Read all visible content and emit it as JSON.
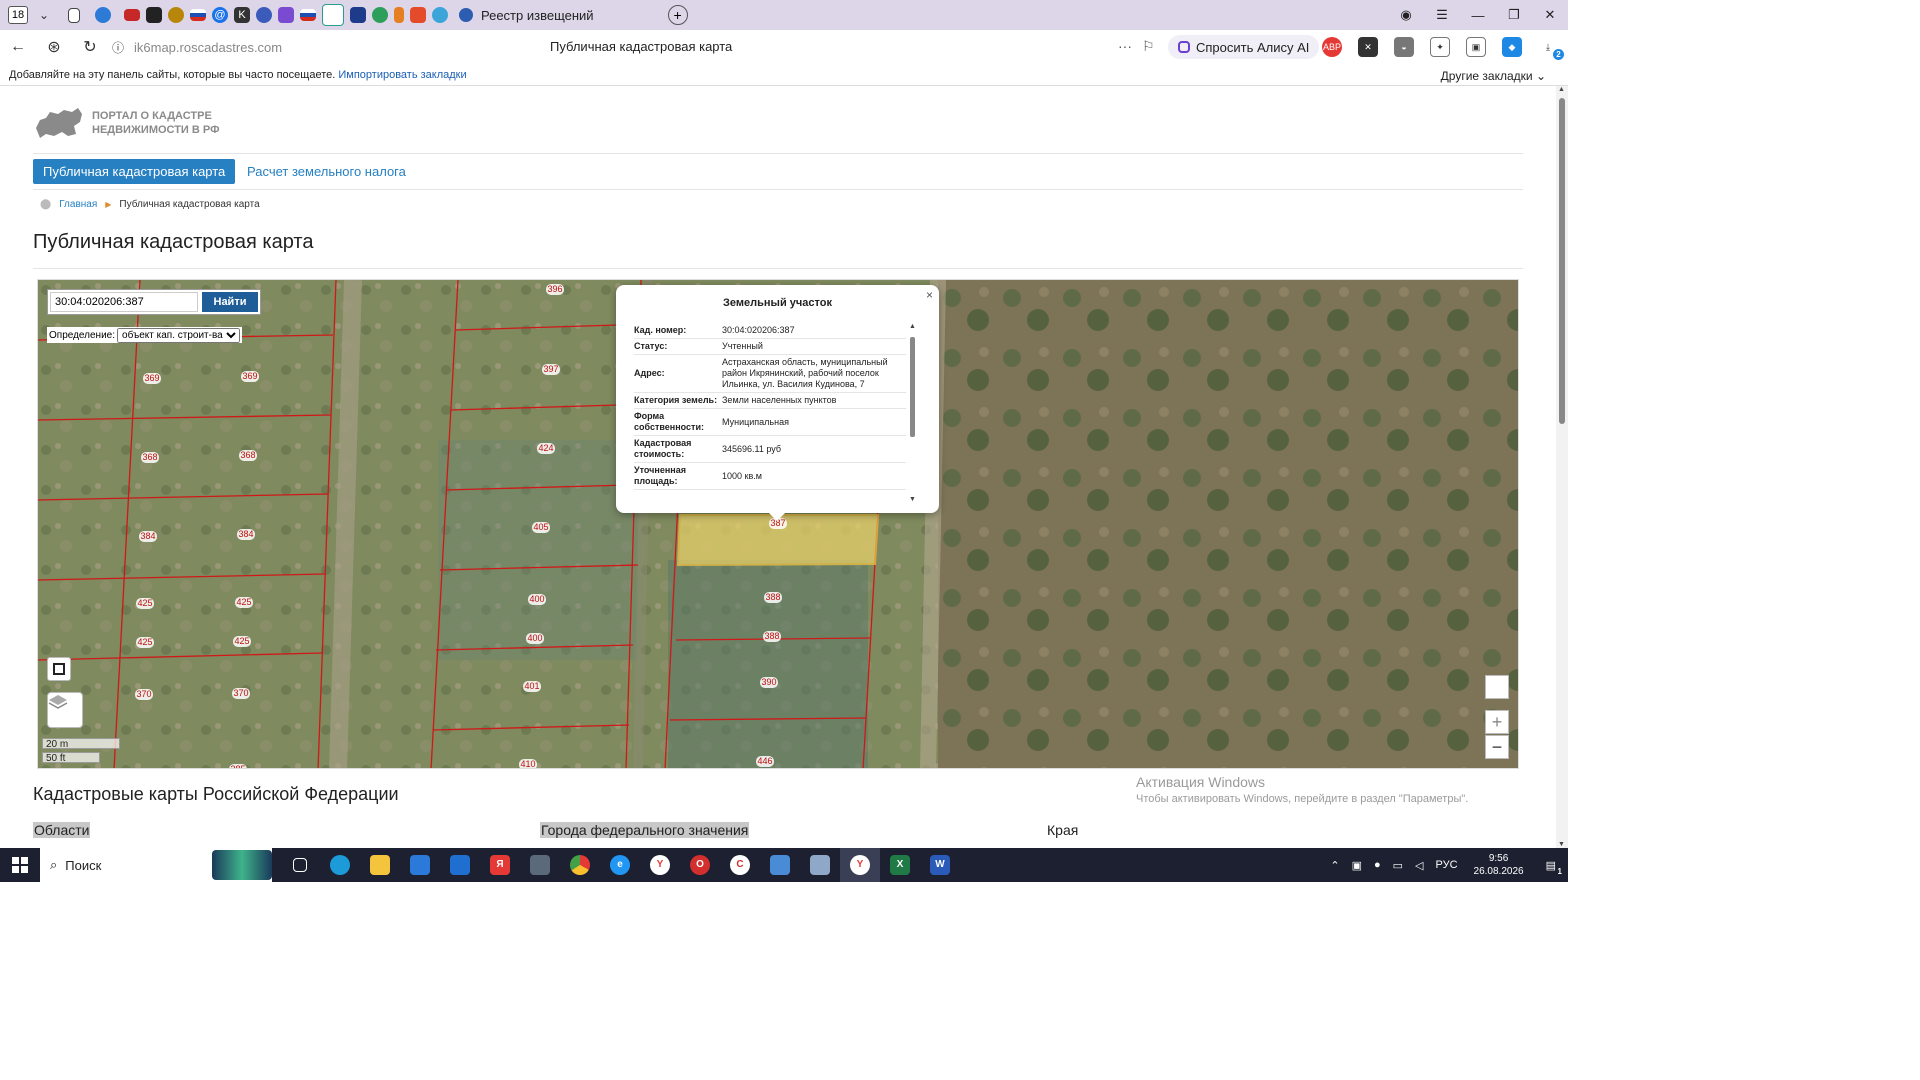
{
  "browser": {
    "tab_count": "18",
    "active_tab_title": "Реестр извещений",
    "url": "ik6map.roscadastres.com",
    "page_title": "Публичная кадастровая карта",
    "alisa_label": "Спросить Алису AI",
    "bookmarks_hint": "Добавляйте на эту панель сайты, которые вы часто посещаете.",
    "bookmarks_import": "Импортировать закладки",
    "other_bookmarks": "Другие закладки",
    "downloads_badge": "2"
  },
  "site": {
    "logo_line1": "ПОРТАЛ О КАДАСТРЕ",
    "logo_line2": "НЕДВИЖИМОСТИ В РФ",
    "nav_active": "Публичная кадастровая карта",
    "nav_other": "Расчет земельного налога",
    "breadcrumb_home": "Главная",
    "breadcrumb_current": "Публичная кадастровая карта",
    "heading": "Публичная кадастровая карта",
    "section_title": "Кадастровые карты Российской Федерации",
    "columns": [
      "Области",
      "Города федерального значения",
      "Края"
    ]
  },
  "map": {
    "search_value": "30:04:020206:387",
    "search_button": "Найти",
    "define_label": "Определение:",
    "define_option": "объект кап. строит-ва",
    "scale_m": "20 m",
    "scale_ft": "50 ft",
    "zoom_in": "+",
    "zoom_out": "−",
    "parcel_labels": [
      "396",
      "397",
      "369",
      "369",
      "424",
      "368",
      "368",
      "405",
      "384",
      "384",
      "387",
      "425",
      "425",
      "400",
      "388",
      "425",
      "425",
      "400",
      "388",
      "401",
      "390",
      "370",
      "370",
      "410",
      "446",
      "385"
    ]
  },
  "popup": {
    "title": "Земельный участок",
    "close": "×",
    "rows": [
      {
        "k": "Кад. номер:",
        "v": "30:04:020206:387"
      },
      {
        "k": "Статус:",
        "v": "Учтенный"
      },
      {
        "k": "Адрес:",
        "v": "Астраханская область, муниципальный район Икрянинский, рабочий поселок Ильинка, ул. Василия Кудинова, 7"
      },
      {
        "k": "Категория земель:",
        "v": "Земли населенных пунктов"
      },
      {
        "k": "Форма собственности:",
        "v": "Муниципальная"
      },
      {
        "k": "Кадастровая стоимость:",
        "v": "345696.11 руб"
      },
      {
        "k": "Уточненная площадь:",
        "v": "1000 кв.м"
      }
    ]
  },
  "watermark": {
    "line1": "Активация Windows",
    "line2": "Чтобы активировать Windows, перейдите в раздел \"Параметры\"."
  },
  "taskbar": {
    "search_label": "Поиск",
    "lang": "РУС",
    "time": "9:56",
    "date": "26.08.2026",
    "notif_count": "1"
  }
}
